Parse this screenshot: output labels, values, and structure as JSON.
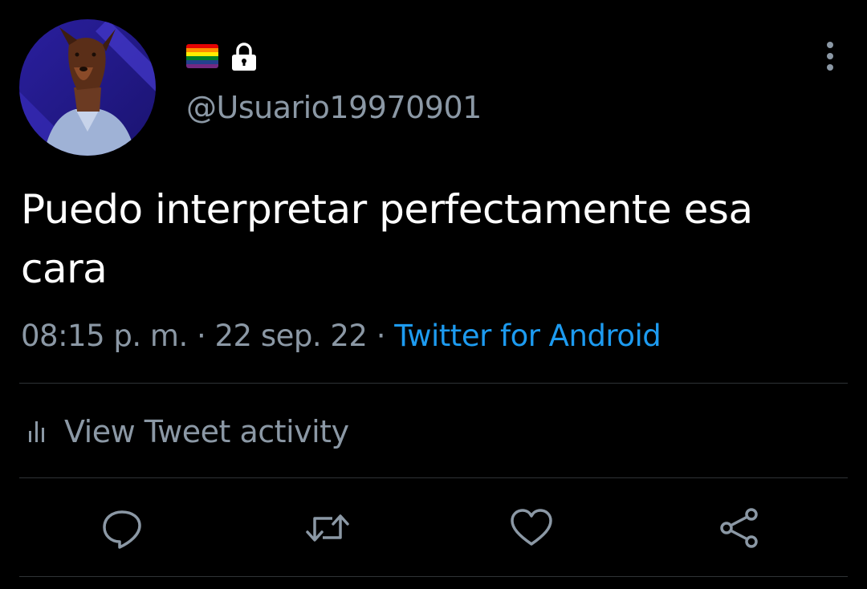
{
  "profile": {
    "avatar_icon": "doberman-avatar",
    "flag_icon": "rainbow-flag-icon",
    "lock_icon": "lock-icon",
    "handle": "@Usuario19970901"
  },
  "tweet": {
    "text": "Puedo interpretar perfectamente esa cara",
    "time": "08:15 p. m.",
    "separator1": " · ",
    "date": "22 sep. 22",
    "separator2": " · ",
    "source": "Twitter for Android"
  },
  "activity": {
    "label": "View Tweet activity",
    "icon": "bar-chart-icon"
  },
  "actions": [
    {
      "icon": "reply-icon"
    },
    {
      "icon": "retweet-icon"
    },
    {
      "icon": "like-icon"
    },
    {
      "icon": "share-icon"
    }
  ],
  "colors": {
    "background": "#000000",
    "primary_text": "#ffffff",
    "secondary_text": "#8b98a5",
    "link": "#1d9bf0",
    "divider": "#2f3336"
  }
}
